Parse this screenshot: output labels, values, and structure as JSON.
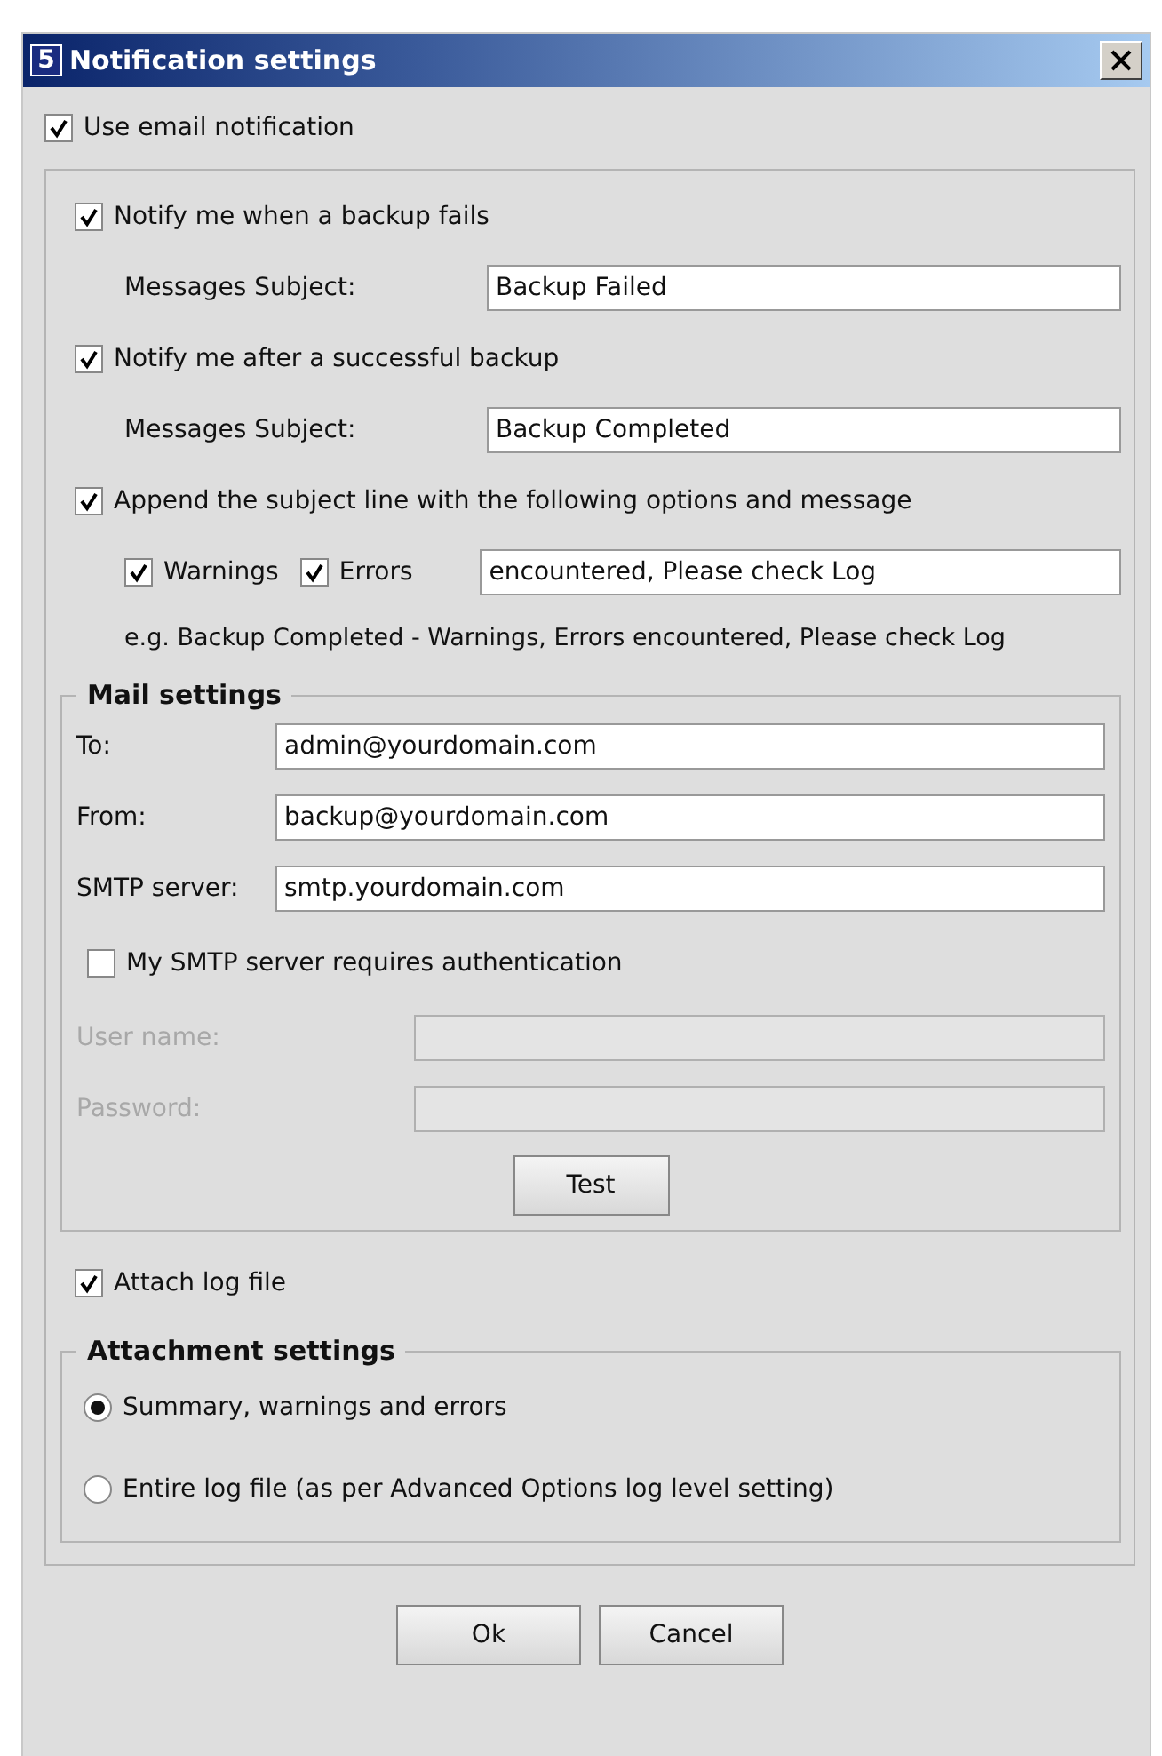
{
  "window": {
    "icon_label": "5",
    "title": "Notification settings"
  },
  "use_email": {
    "label": "Use email notification",
    "checked": true
  },
  "notifications": [
    {
      "label": "Notify me when a backup fails",
      "checked": true,
      "subject_label": "Messages Subject:",
      "subject": "Backup Failed"
    },
    {
      "label": "Notify me after a successful backup",
      "checked": true,
      "subject_label": "Messages Subject:",
      "subject": "Backup Completed"
    }
  ],
  "append": {
    "label": "Append the subject line with the following options and message",
    "checked": true,
    "options": [
      {
        "label": "Warnings",
        "checked": true
      },
      {
        "label": "Errors",
        "checked": true
      }
    ],
    "message": "encountered, Please check Log",
    "example": "e.g. Backup Completed - Warnings, Errors encountered, Please check Log"
  },
  "mail_settings": {
    "title": "Mail settings",
    "fields": [
      {
        "label": "To:",
        "value": "admin@yourdomain.com",
        "disabled": false
      },
      {
        "label": "From:",
        "value": "backup@yourdomain.com",
        "disabled": false
      },
      {
        "label": "SMTP server:",
        "value": "smtp.yourdomain.com",
        "disabled": false
      }
    ],
    "auth": {
      "label": "My SMTP server requires authentication",
      "checked": false
    },
    "auth_fields": [
      {
        "label": "User name:",
        "disabled": true
      },
      {
        "label": "Password:",
        "disabled": true
      }
    ],
    "test_button": "Test"
  },
  "attach_log": {
    "label": "Attach log file",
    "checked": true
  },
  "attachment_settings": {
    "title": "Attachment settings",
    "options": [
      {
        "label": "Summary, warnings and errors",
        "selected": true
      },
      {
        "label": "Entire log file (as per Advanced Options log level setting)",
        "selected": false
      }
    ]
  },
  "buttons": [
    "Ok",
    "Cancel"
  ]
}
